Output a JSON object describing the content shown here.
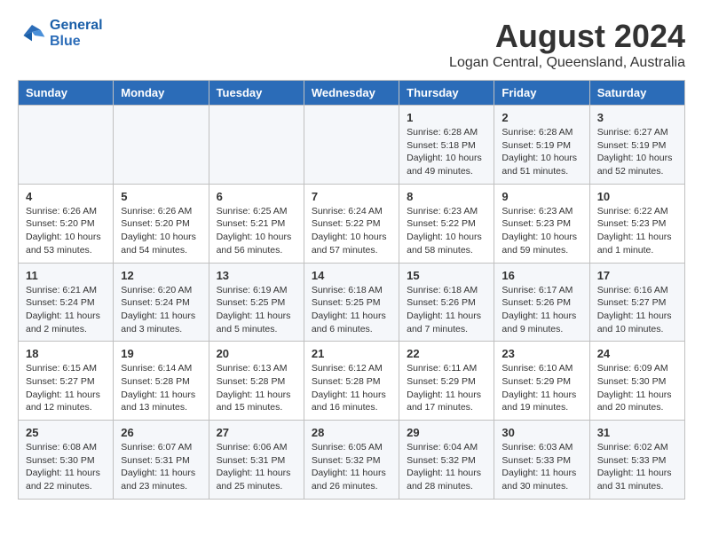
{
  "header": {
    "logo_line1": "General",
    "logo_line2": "Blue",
    "month_year": "August 2024",
    "location": "Logan Central, Queensland, Australia"
  },
  "days_of_week": [
    "Sunday",
    "Monday",
    "Tuesday",
    "Wednesday",
    "Thursday",
    "Friday",
    "Saturday"
  ],
  "weeks": [
    [
      {
        "day": "",
        "info": ""
      },
      {
        "day": "",
        "info": ""
      },
      {
        "day": "",
        "info": ""
      },
      {
        "day": "",
        "info": ""
      },
      {
        "day": "1",
        "info": "Sunrise: 6:28 AM\nSunset: 5:18 PM\nDaylight: 10 hours\nand 49 minutes."
      },
      {
        "day": "2",
        "info": "Sunrise: 6:28 AM\nSunset: 5:19 PM\nDaylight: 10 hours\nand 51 minutes."
      },
      {
        "day": "3",
        "info": "Sunrise: 6:27 AM\nSunset: 5:19 PM\nDaylight: 10 hours\nand 52 minutes."
      }
    ],
    [
      {
        "day": "4",
        "info": "Sunrise: 6:26 AM\nSunset: 5:20 PM\nDaylight: 10 hours\nand 53 minutes."
      },
      {
        "day": "5",
        "info": "Sunrise: 6:26 AM\nSunset: 5:20 PM\nDaylight: 10 hours\nand 54 minutes."
      },
      {
        "day": "6",
        "info": "Sunrise: 6:25 AM\nSunset: 5:21 PM\nDaylight: 10 hours\nand 56 minutes."
      },
      {
        "day": "7",
        "info": "Sunrise: 6:24 AM\nSunset: 5:22 PM\nDaylight: 10 hours\nand 57 minutes."
      },
      {
        "day": "8",
        "info": "Sunrise: 6:23 AM\nSunset: 5:22 PM\nDaylight: 10 hours\nand 58 minutes."
      },
      {
        "day": "9",
        "info": "Sunrise: 6:23 AM\nSunset: 5:23 PM\nDaylight: 10 hours\nand 59 minutes."
      },
      {
        "day": "10",
        "info": "Sunrise: 6:22 AM\nSunset: 5:23 PM\nDaylight: 11 hours\nand 1 minute."
      }
    ],
    [
      {
        "day": "11",
        "info": "Sunrise: 6:21 AM\nSunset: 5:24 PM\nDaylight: 11 hours\nand 2 minutes."
      },
      {
        "day": "12",
        "info": "Sunrise: 6:20 AM\nSunset: 5:24 PM\nDaylight: 11 hours\nand 3 minutes."
      },
      {
        "day": "13",
        "info": "Sunrise: 6:19 AM\nSunset: 5:25 PM\nDaylight: 11 hours\nand 5 minutes."
      },
      {
        "day": "14",
        "info": "Sunrise: 6:18 AM\nSunset: 5:25 PM\nDaylight: 11 hours\nand 6 minutes."
      },
      {
        "day": "15",
        "info": "Sunrise: 6:18 AM\nSunset: 5:26 PM\nDaylight: 11 hours\nand 7 minutes."
      },
      {
        "day": "16",
        "info": "Sunrise: 6:17 AM\nSunset: 5:26 PM\nDaylight: 11 hours\nand 9 minutes."
      },
      {
        "day": "17",
        "info": "Sunrise: 6:16 AM\nSunset: 5:27 PM\nDaylight: 11 hours\nand 10 minutes."
      }
    ],
    [
      {
        "day": "18",
        "info": "Sunrise: 6:15 AM\nSunset: 5:27 PM\nDaylight: 11 hours\nand 12 minutes."
      },
      {
        "day": "19",
        "info": "Sunrise: 6:14 AM\nSunset: 5:28 PM\nDaylight: 11 hours\nand 13 minutes."
      },
      {
        "day": "20",
        "info": "Sunrise: 6:13 AM\nSunset: 5:28 PM\nDaylight: 11 hours\nand 15 minutes."
      },
      {
        "day": "21",
        "info": "Sunrise: 6:12 AM\nSunset: 5:28 PM\nDaylight: 11 hours\nand 16 minutes."
      },
      {
        "day": "22",
        "info": "Sunrise: 6:11 AM\nSunset: 5:29 PM\nDaylight: 11 hours\nand 17 minutes."
      },
      {
        "day": "23",
        "info": "Sunrise: 6:10 AM\nSunset: 5:29 PM\nDaylight: 11 hours\nand 19 minutes."
      },
      {
        "day": "24",
        "info": "Sunrise: 6:09 AM\nSunset: 5:30 PM\nDaylight: 11 hours\nand 20 minutes."
      }
    ],
    [
      {
        "day": "25",
        "info": "Sunrise: 6:08 AM\nSunset: 5:30 PM\nDaylight: 11 hours\nand 22 minutes."
      },
      {
        "day": "26",
        "info": "Sunrise: 6:07 AM\nSunset: 5:31 PM\nDaylight: 11 hours\nand 23 minutes."
      },
      {
        "day": "27",
        "info": "Sunrise: 6:06 AM\nSunset: 5:31 PM\nDaylight: 11 hours\nand 25 minutes."
      },
      {
        "day": "28",
        "info": "Sunrise: 6:05 AM\nSunset: 5:32 PM\nDaylight: 11 hours\nand 26 minutes."
      },
      {
        "day": "29",
        "info": "Sunrise: 6:04 AM\nSunset: 5:32 PM\nDaylight: 11 hours\nand 28 minutes."
      },
      {
        "day": "30",
        "info": "Sunrise: 6:03 AM\nSunset: 5:33 PM\nDaylight: 11 hours\nand 30 minutes."
      },
      {
        "day": "31",
        "info": "Sunrise: 6:02 AM\nSunset: 5:33 PM\nDaylight: 11 hours\nand 31 minutes."
      }
    ]
  ]
}
